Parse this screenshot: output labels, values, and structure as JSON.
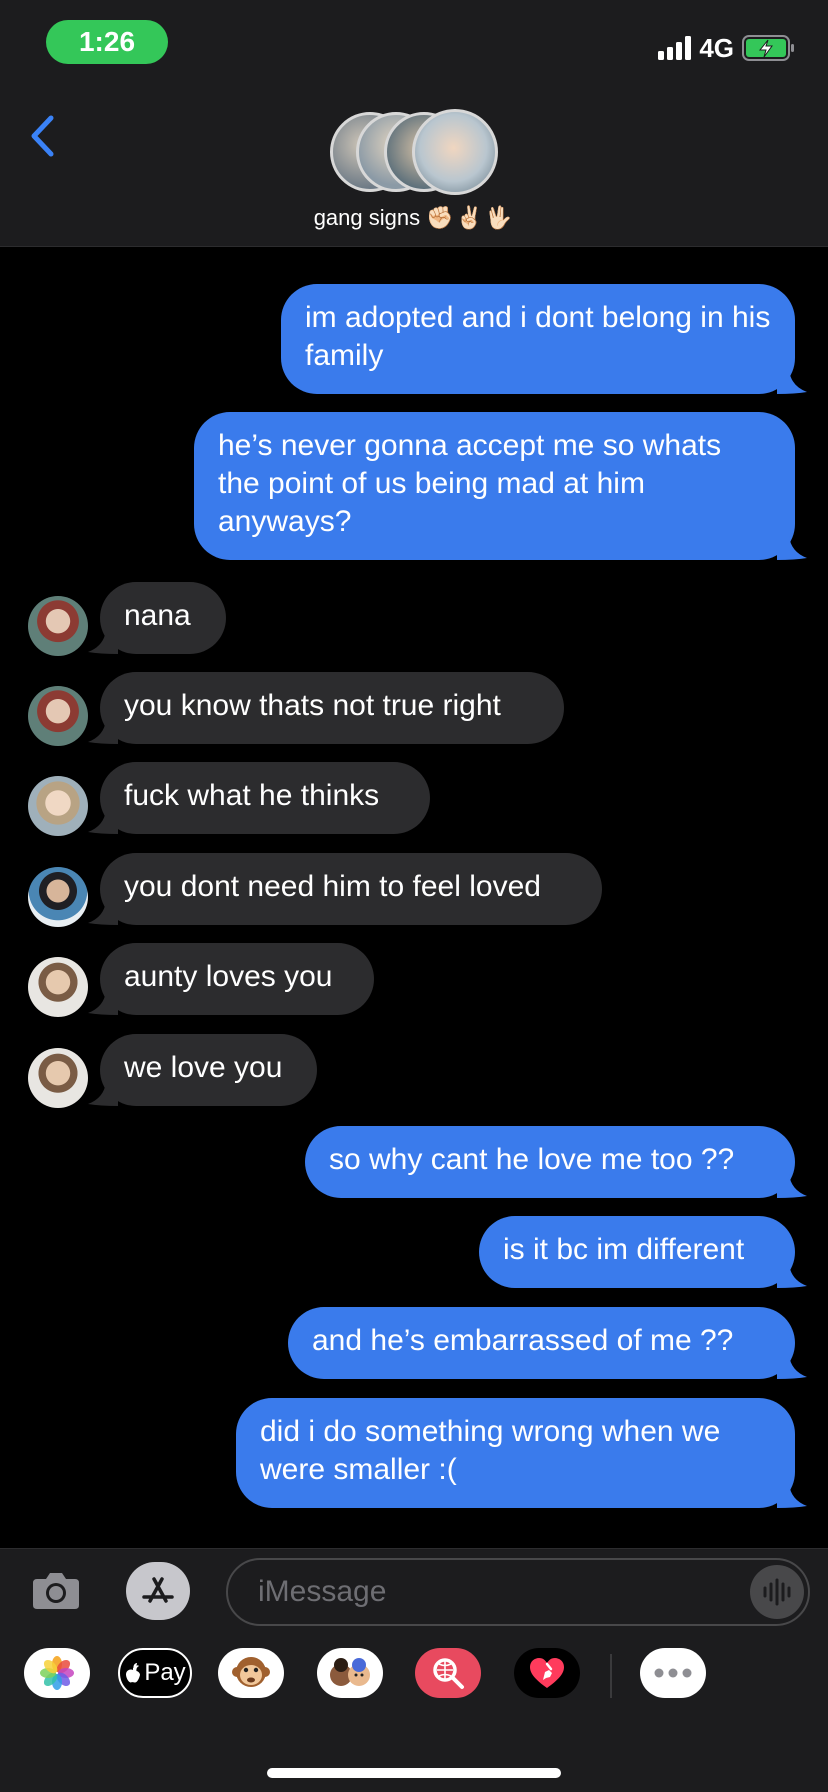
{
  "status_bar": {
    "time": "1:26",
    "network": "4G"
  },
  "conversation": {
    "name": "gang signs",
    "emojis": "✊🏻✌🏻🖖🏻"
  },
  "messages": [
    {
      "direction": "out",
      "text": "im adopted and i dont belong in his family"
    },
    {
      "direction": "out",
      "text": "he’s never gonna accept me so whats the point of us being mad at him anyways?"
    },
    {
      "direction": "in",
      "text": "nana"
    },
    {
      "direction": "in",
      "text": "you know thats not true right"
    },
    {
      "direction": "in",
      "text": "fuck what he thinks"
    },
    {
      "direction": "in",
      "text": "you dont need him to feel loved"
    },
    {
      "direction": "in",
      "text": "aunty loves you"
    },
    {
      "direction": "in",
      "text": "we love you"
    },
    {
      "direction": "out",
      "text": "so why cant he love me too ??"
    },
    {
      "direction": "out",
      "text": "is it bc im different"
    },
    {
      "direction": "out",
      "text": "and he’s embarrassed of me ??"
    },
    {
      "direction": "out",
      "text": "did i do something wrong when we were smaller :("
    }
  ],
  "composer": {
    "placeholder": "iMessage",
    "apple_pay_label": "Pay"
  },
  "app_drawer": [
    "photos-app-icon",
    "apple-pay-icon",
    "animoji-monkey-icon",
    "memoji-stickers-icon",
    "image-search-icon",
    "digital-touch-icon",
    "more-apps-icon"
  ],
  "colors": {
    "outgoing_bubble": "#3a7bec",
    "incoming_bubble": "#2c2c2e",
    "accent": "#3a82f7",
    "time_pill": "#34c759"
  }
}
